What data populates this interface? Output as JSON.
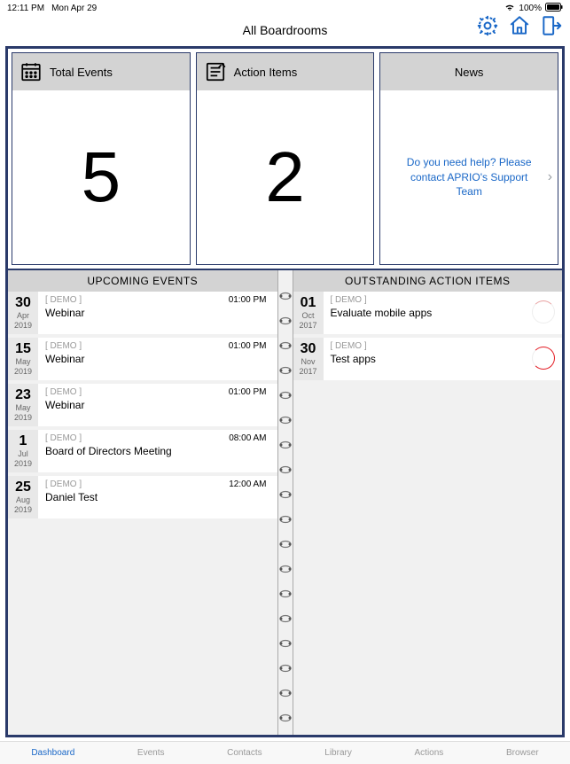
{
  "statusbar": {
    "time": "12:11 PM",
    "date": "Mon Apr 29",
    "wifi": "wifi",
    "battery_pct": "100%"
  },
  "header": {
    "title": "All Boardrooms"
  },
  "cards": {
    "total_events": {
      "label": "Total Events",
      "value": "5"
    },
    "action_items": {
      "label": "Action Items",
      "value": "2"
    },
    "news": {
      "label": "News",
      "text": "Do you need help?  Please contact APRIO's Support Team"
    }
  },
  "upcoming": {
    "heading": "UPCOMING EVENTS",
    "items": [
      {
        "day": "30",
        "month": "Apr",
        "year": "2019",
        "tag": "[ DEMO ]",
        "title": "Webinar",
        "time": "01:00 PM"
      },
      {
        "day": "15",
        "month": "May",
        "year": "2019",
        "tag": "[ DEMO ]",
        "title": "Webinar",
        "time": "01:00 PM"
      },
      {
        "day": "23",
        "month": "May",
        "year": "2019",
        "tag": "[ DEMO ]",
        "title": "Webinar",
        "time": "01:00 PM"
      },
      {
        "day": "1",
        "month": "Jul",
        "year": "2019",
        "tag": "[ DEMO ]",
        "title": "Board of Directors Meeting",
        "time": "08:00 AM"
      },
      {
        "day": "25",
        "month": "Aug",
        "year": "2019",
        "tag": "[ DEMO ]",
        "title": "Daniel Test",
        "time": "12:00 AM"
      }
    ]
  },
  "outstanding": {
    "heading": "OUTSTANDING ACTION ITEMS",
    "items": [
      {
        "day": "01",
        "month": "Oct",
        "year": "2017",
        "tag": "[ DEMO ]",
        "title": "Evaluate mobile apps",
        "badge": "badge1"
      },
      {
        "day": "30",
        "month": "Nov",
        "year": "2017",
        "tag": "[ DEMO ]",
        "title": "Test apps",
        "badge": "badge2"
      }
    ]
  },
  "tabs": {
    "items": [
      "Dashboard",
      "Events",
      "Contacts",
      "Library",
      "Actions",
      "Browser"
    ],
    "active": 0
  }
}
